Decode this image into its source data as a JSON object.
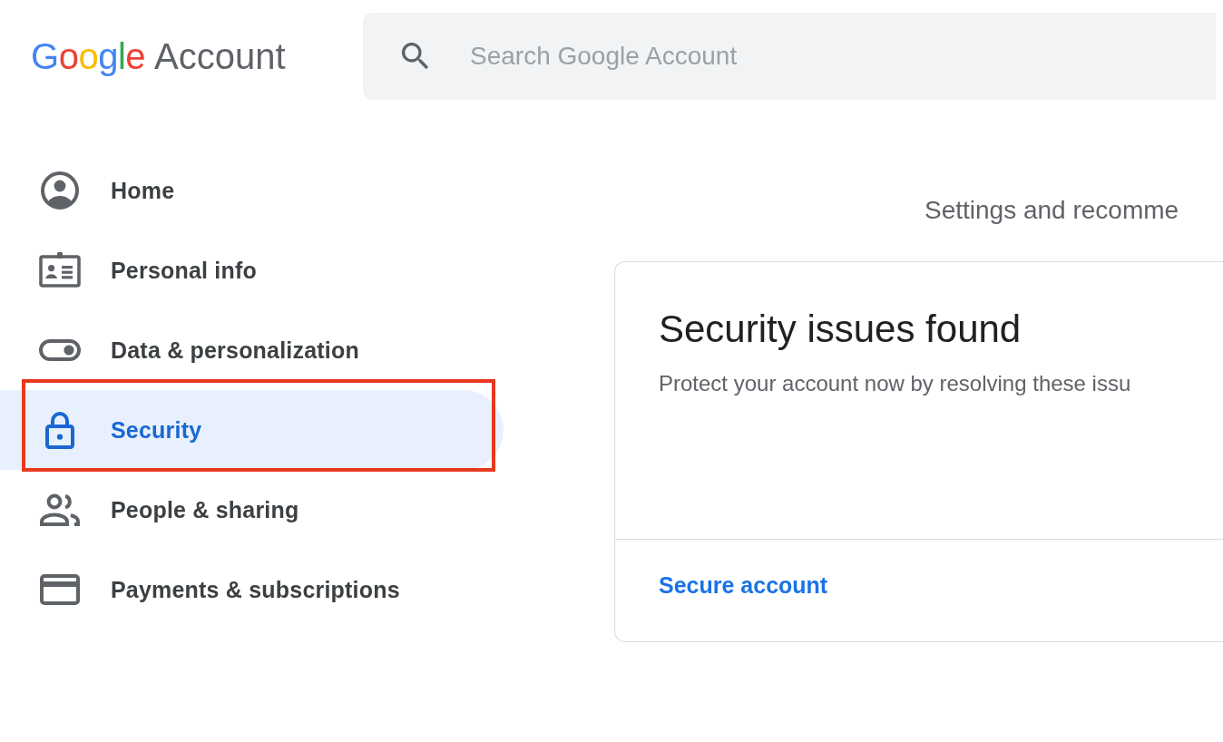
{
  "logo": {
    "letters": [
      {
        "char": "G",
        "color": "#4285f4"
      },
      {
        "char": "o",
        "color": "#ea4335"
      },
      {
        "char": "o",
        "color": "#fbbc05"
      },
      {
        "char": "g",
        "color": "#4285f4"
      },
      {
        "char": "l",
        "color": "#34a853"
      },
      {
        "char": "e",
        "color": "#ea4335"
      }
    ],
    "product": "Account"
  },
  "search": {
    "placeholder": "Search Google Account"
  },
  "sidebar": {
    "items": [
      {
        "kind": "home",
        "label": "Home",
        "selected": false,
        "annotated": false
      },
      {
        "kind": "personal",
        "label": "Personal info",
        "selected": false,
        "annotated": false
      },
      {
        "kind": "data",
        "label": "Data & personalization",
        "selected": false,
        "annotated": false
      },
      {
        "kind": "security",
        "label": "Security",
        "selected": true,
        "annotated": true
      },
      {
        "kind": "people",
        "label": "People & sharing",
        "selected": false,
        "annotated": false
      },
      {
        "kind": "payments",
        "label": "Payments & subscriptions",
        "selected": false,
        "annotated": false
      }
    ]
  },
  "main": {
    "intro": "Settings and recomme",
    "card": {
      "title": "Security issues found",
      "text": "Protect your account now by resolving these issu",
      "link": "Secure account"
    }
  }
}
